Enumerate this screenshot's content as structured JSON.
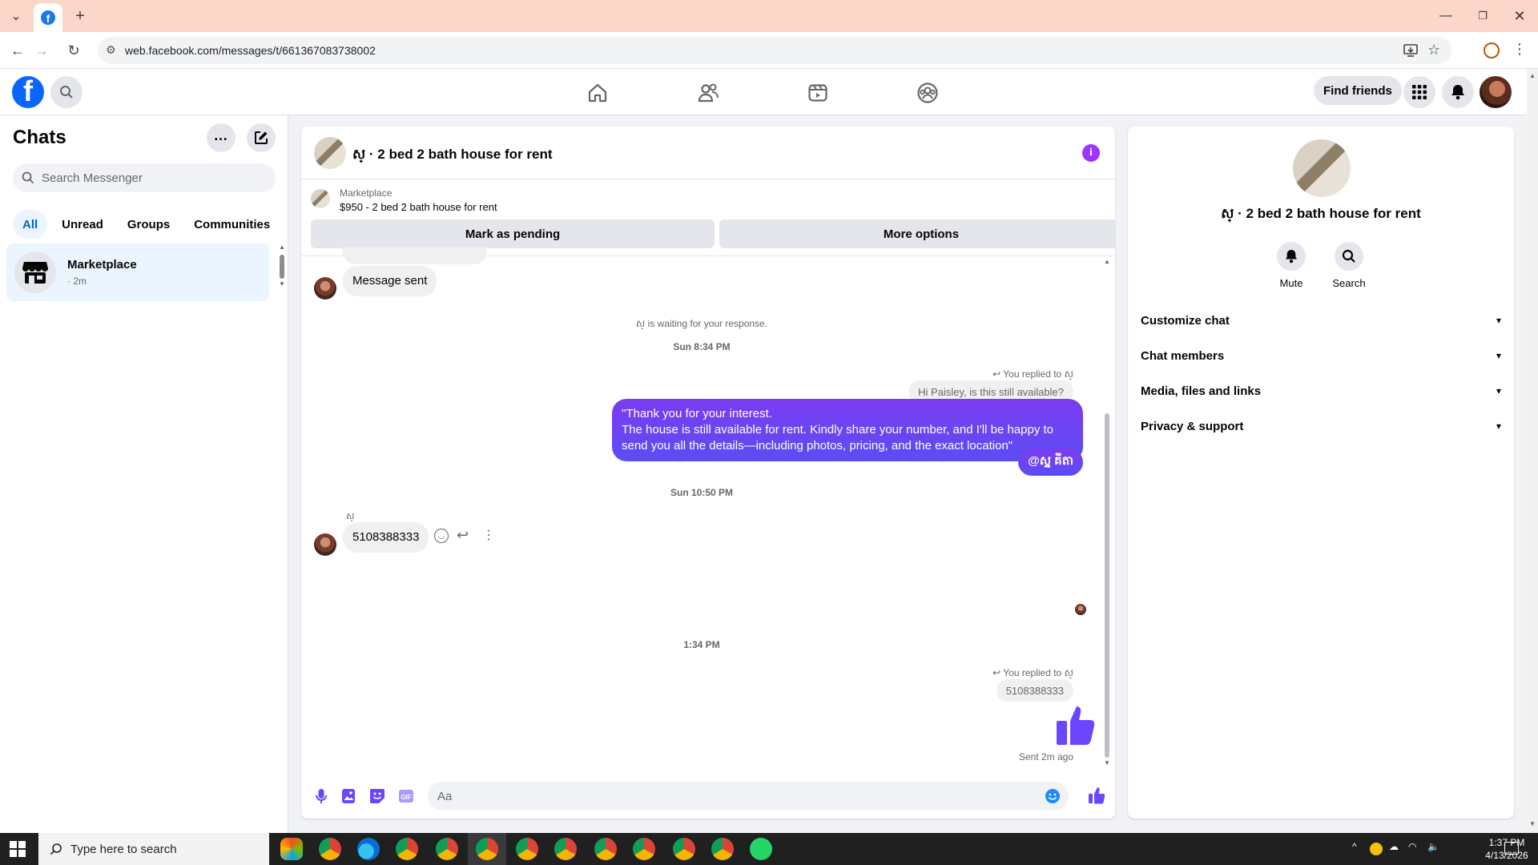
{
  "browser": {
    "url": "web.facebook.com/messages/t/661367083738002",
    "tab_favicon": "f"
  },
  "fb_header": {
    "logo": "f",
    "find_friends": "Find friends"
  },
  "sidebar": {
    "title": "Chats",
    "search_placeholder": "Search Messenger",
    "filters": [
      "All",
      "Unread",
      "Groups",
      "Communities"
    ],
    "chats": [
      {
        "name": "Marketplace",
        "time": "· 2m"
      }
    ]
  },
  "conversation": {
    "title": "ស្ · 2 bed 2 bath house for rent",
    "marketplace_label": "Marketplace",
    "listing": "$950 - 2 bed 2 bath house for rent",
    "mark_pending": "Mark as pending",
    "more_options": "More options",
    "messages": {
      "message_sent": "Message sent",
      "waiting": "ស្ is waiting for your response.",
      "time1": "Sun 8:34 PM",
      "replied1": "You replied to ស្",
      "quote1": "Hi Paisley, is this still available?",
      "out1_line1": "\"Thank you for your interest.",
      "out1_line2": "The house is still available for rent. Kindly share your number, and I'll be happy to",
      "out1_line3": "send you all the details—including photos, pricing, and the exact location\"",
      "out2": "@ស្ន គីតា",
      "time2": "Sun 10:50 PM",
      "sender_name": "ស្",
      "in_number": "5108388333",
      "time3": "1:34 PM",
      "replied2": "You replied to ស្",
      "quote2": "5108388333",
      "sent_status": "Sent 2m ago"
    },
    "composer_placeholder": "Aa"
  },
  "details": {
    "title": "ស្ · 2 bed 2 bath house for rent",
    "actions": [
      {
        "label": "Mute",
        "icon": "bell-icon"
      },
      {
        "label": "Search",
        "icon": "search-icon"
      }
    ],
    "sections": [
      "Customize chat",
      "Chat members",
      "Media, files and links",
      "Privacy & support"
    ]
  },
  "taskbar": {
    "search_placeholder": "Type here to search",
    "time": "1:37 PM",
    "date": "4/13/2026"
  },
  "colors": {
    "brand": "#0866ff",
    "bubble_out": "#6b46ff",
    "accent_purple": "#a033ff"
  }
}
